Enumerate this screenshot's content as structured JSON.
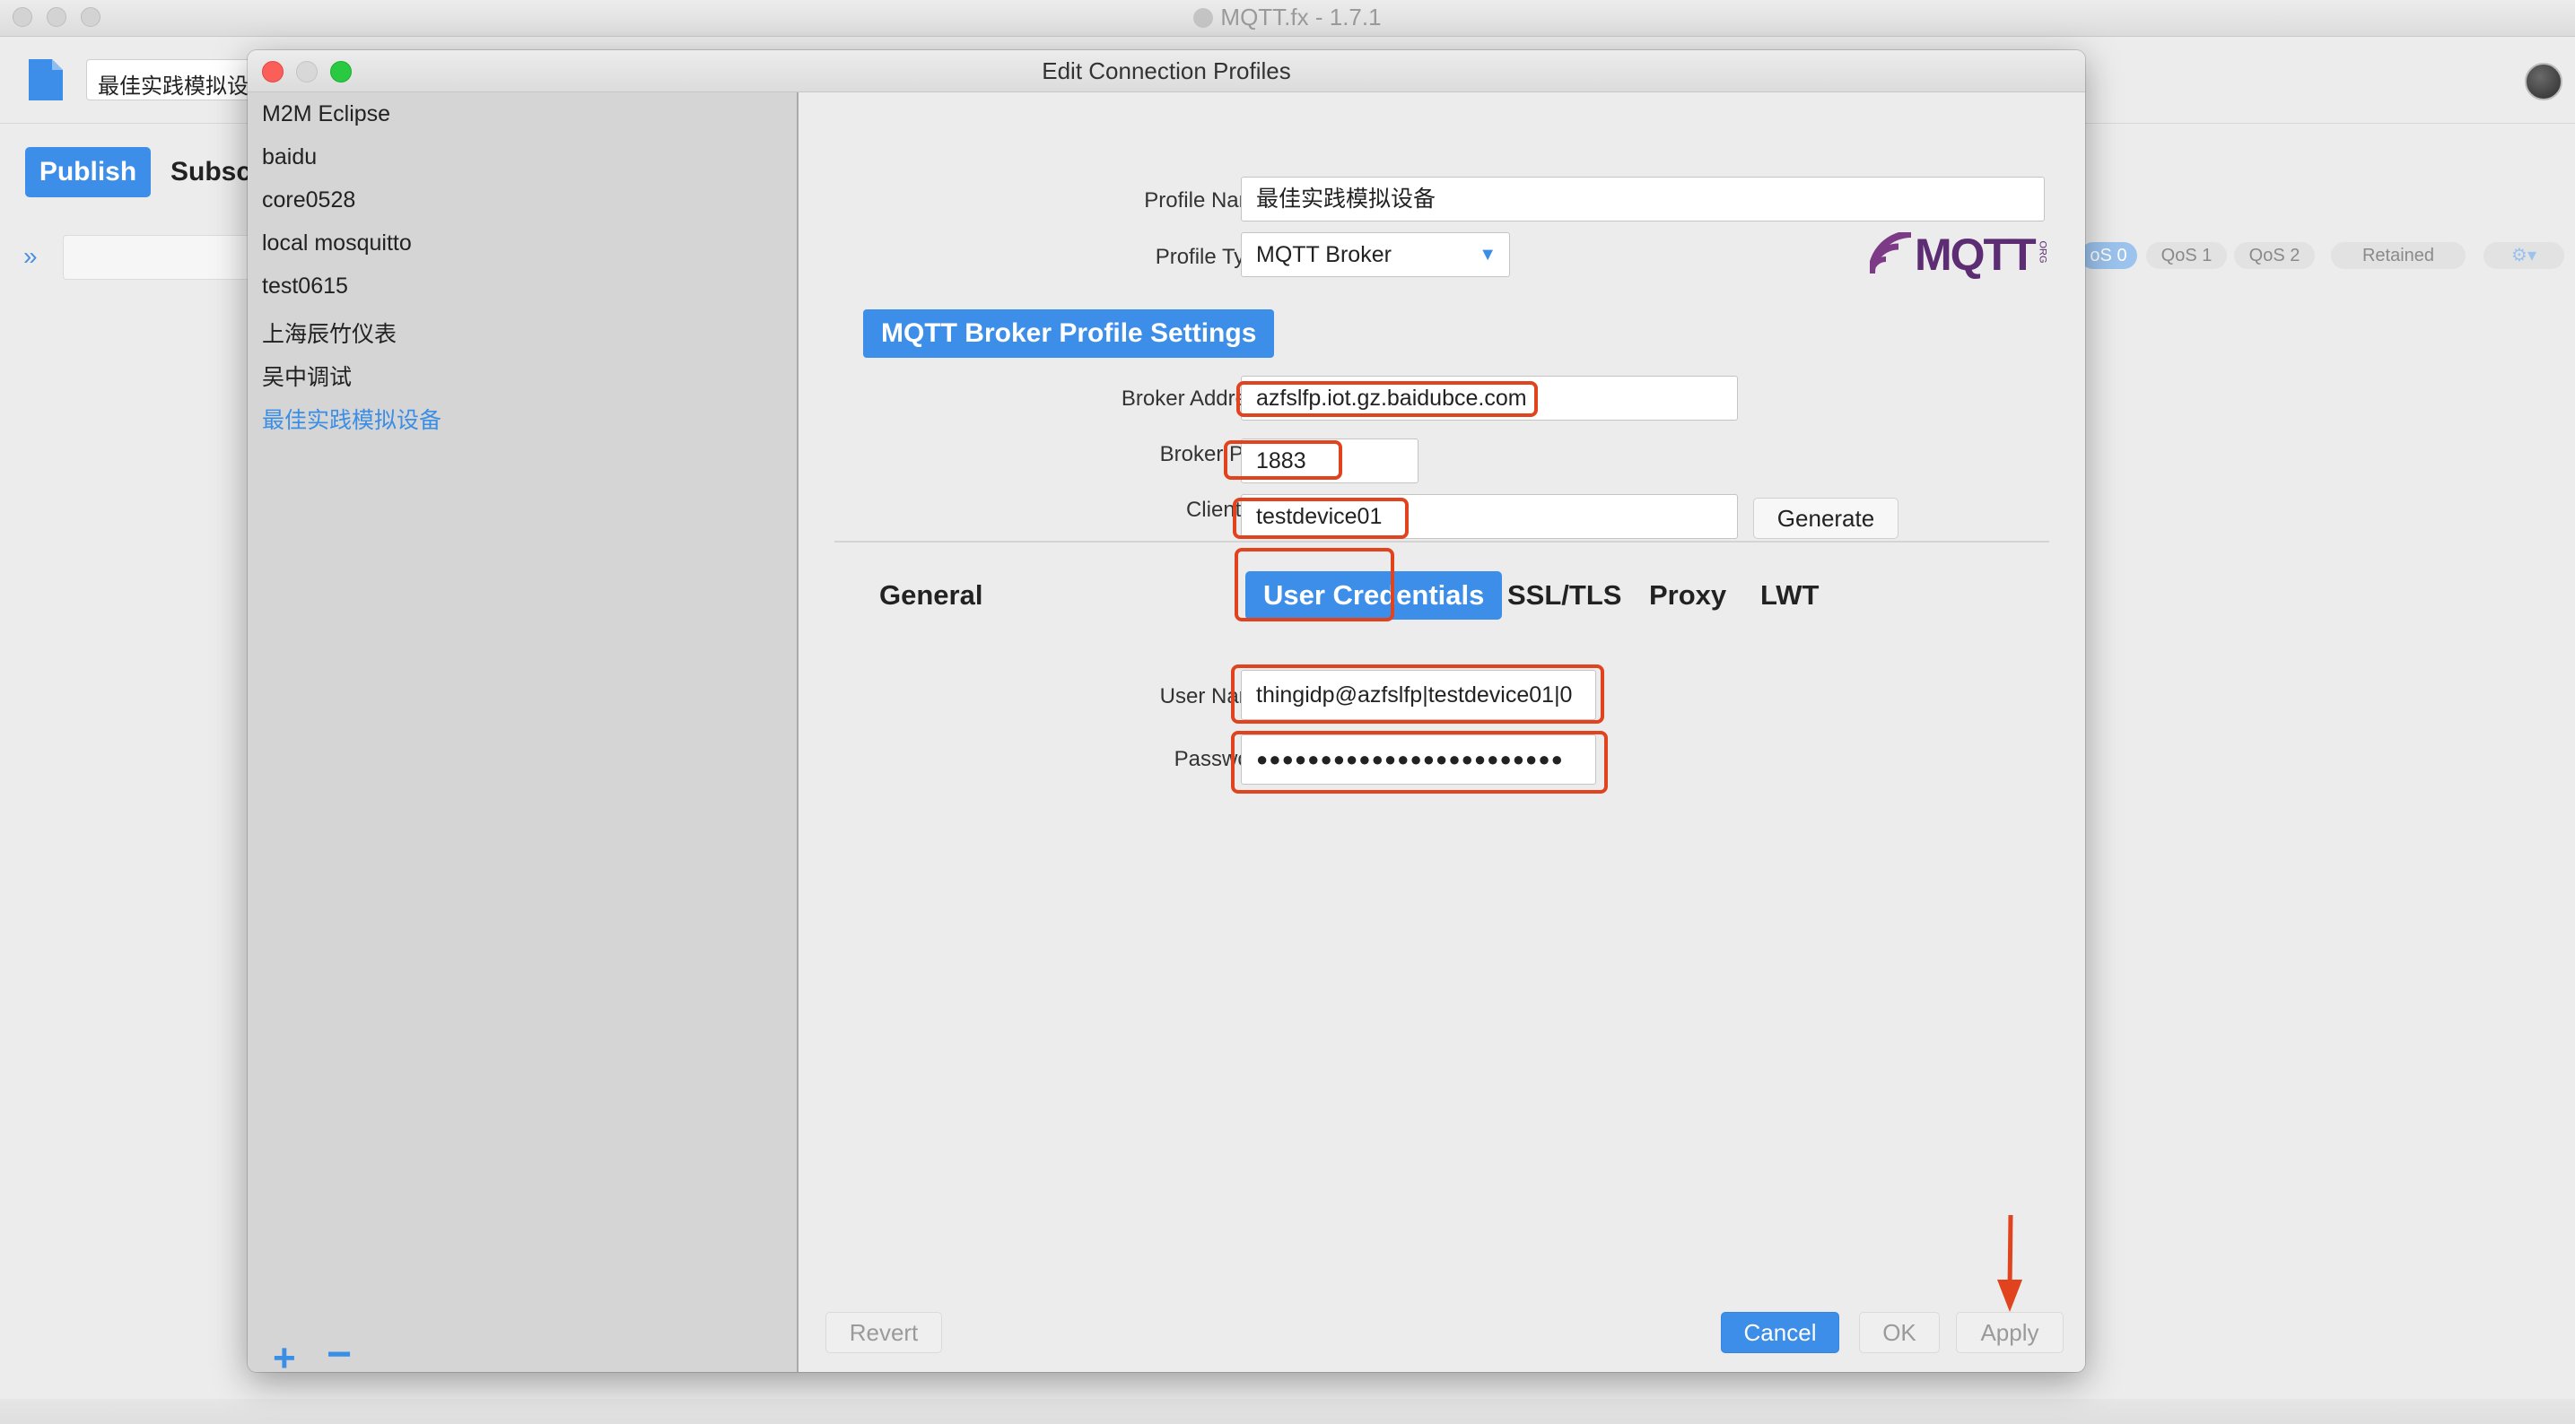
{
  "main_window": {
    "title": "MQTT.fx - 1.7.1",
    "profile_combo_value": "最佳实践模拟设",
    "tabs": {
      "publish": "Publish",
      "subscribe": "Subscr"
    },
    "qos_buttons": [
      "oS 0",
      "QoS 1",
      "QoS 2",
      "Retained"
    ]
  },
  "dialog": {
    "title": "Edit Connection Profiles",
    "profiles": [
      "M2M Eclipse",
      "baidu",
      "core0528",
      "local mosquitto",
      "test0615",
      "上海辰竹仪表",
      "吴中调试",
      "最佳实践模拟设备"
    ],
    "selected_profile": "最佳实践模拟设备",
    "profile_name_label": "Profile Name",
    "profile_name_value": "最佳实践模拟设备",
    "profile_type_label": "Profile Type",
    "profile_type_value": "MQTT Broker",
    "logo_text": "MQTT",
    "logo_org": "ORG",
    "section_heading": "MQTT Broker Profile Settings",
    "broker_address_label": "Broker Address",
    "broker_address_value": "azfslfp.iot.gz.baidubce.com",
    "broker_port_label": "Broker Port",
    "broker_port_value": "1883",
    "client_id_label": "Client ID",
    "client_id_value": "testdevice01",
    "generate_button": "Generate",
    "subtabs": {
      "general": "General",
      "user_credentials": "User Credentials",
      "ssl_tls": "SSL/TLS",
      "proxy": "Proxy",
      "lwt": "LWT"
    },
    "active_subtab": "User Credentials",
    "user_name_label": "User Name",
    "user_name_value": "thingidp@azfslfp|testdevice01|0",
    "password_label": "Password",
    "password_value": "●●●●●●●●●●●●●●●●●●●●●●●●",
    "buttons": {
      "revert": "Revert",
      "cancel": "Cancel",
      "ok": "OK",
      "apply": "Apply"
    }
  },
  "colors": {
    "accent": "#3d8ee8",
    "highlight": "#e0431d",
    "close": "#fc5f57",
    "minimize": "#d8d8d8",
    "zoom": "#29c941"
  }
}
